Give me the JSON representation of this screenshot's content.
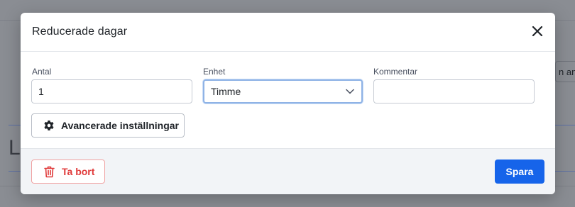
{
  "background": {
    "tab_text": "n ans",
    "big_letter": "L"
  },
  "modal": {
    "title": "Reducerade dagar",
    "close_icon": "close-icon"
  },
  "form": {
    "antal": {
      "label": "Antal",
      "value": "1"
    },
    "enhet": {
      "label": "Enhet",
      "value": "Timme"
    },
    "kommentar": {
      "label": "Kommentar",
      "value": ""
    }
  },
  "advanced_button": {
    "label": "Avancerade inställningar",
    "icon": "gear-icon"
  },
  "footer": {
    "delete_label": "Ta bort",
    "delete_icon": "trash-icon",
    "save_label": "Spara"
  },
  "colors": {
    "primary": "#1664ea",
    "danger": "#e03a3a",
    "overlay": "#8a8d93"
  }
}
